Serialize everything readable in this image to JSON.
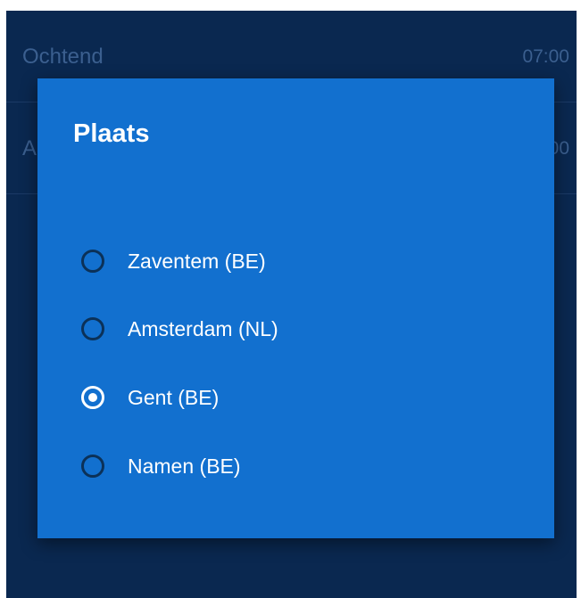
{
  "background": {
    "rows": [
      {
        "label": "Ochtend",
        "time": "07:00"
      },
      {
        "label": "A",
        "time": "00"
      }
    ]
  },
  "dialog": {
    "title": "Plaats",
    "options": [
      {
        "label": "Zaventem (BE)",
        "selected": false
      },
      {
        "label": "Amsterdam (NL)",
        "selected": false
      },
      {
        "label": "Gent (BE)",
        "selected": true
      },
      {
        "label": "Namen (BE)",
        "selected": false
      }
    ]
  },
  "colors": {
    "background": "#0a2850",
    "dialog": "#1270cf",
    "radio_unselected": "#0b3158",
    "radio_selected": "#ffffff",
    "text": "#ffffff"
  }
}
